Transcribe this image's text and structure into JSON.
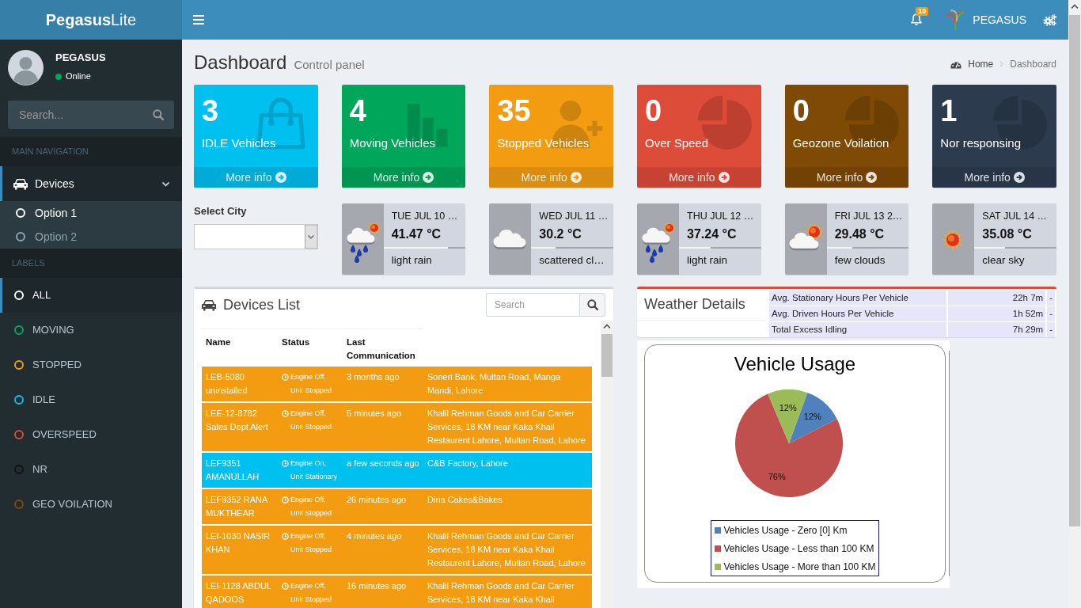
{
  "logo": {
    "text": "**Pegasus**Lite"
  },
  "navbar": {
    "notification_count": "10",
    "user_name": "PEGASUS"
  },
  "sidebar": {
    "user": {
      "name": "PEGASUS",
      "status": "Online"
    },
    "search": {
      "placeholder": "Search..."
    },
    "main_navigation": {
      "header": "MAIN NAVIGATION",
      "items": [
        {
          "label": "Devices",
          "selected": true,
          "expanded": true,
          "children": [
            {
              "label": "Option 1",
              "selected": true
            },
            {
              "label": "Option 2",
              "selected": false
            }
          ]
        }
      ]
    },
    "labels": {
      "header": "LABELS",
      "items": [
        {
          "label": "ALL",
          "color": "#ffffff",
          "selected": true
        },
        {
          "label": "MOVING",
          "color": "#00a65a",
          "selected": false
        },
        {
          "label": "STOPPED",
          "color": "#f39c12",
          "selected": false
        },
        {
          "label": "IDLE",
          "color": "#00c0ef",
          "selected": false
        },
        {
          "label": "OVERSPEED",
          "color": "#dd4b39",
          "selected": false
        },
        {
          "label": "NR",
          "color": "#111111",
          "selected": false
        },
        {
          "label": "GEO VOILATION",
          "color": "#7f4a05",
          "selected": false
        }
      ]
    }
  },
  "page_header": {
    "title": "Dashboard",
    "subtitle": "Control panel",
    "breadcrumb": [
      {
        "label": "Home",
        "selected": false
      },
      {
        "label": "Dashboard",
        "selected": true
      }
    ]
  },
  "stat_boxes": [
    {
      "count": "3",
      "label": "IDLE Vehicles",
      "link": "More info",
      "color": "#00c0ef",
      "kind": "bag"
    },
    {
      "count": "4",
      "label": "Moving Vehicles",
      "link": "More info",
      "color": "#00a65a",
      "kind": "bars"
    },
    {
      "count": "35",
      "label": "Stopped Vehicles",
      "link": "More info",
      "color": "#f39c12",
      "kind": "person_add"
    },
    {
      "count": "0",
      "label": "Over Speed",
      "link": "More info",
      "color": "#dd4b39",
      "kind": "pie"
    },
    {
      "count": "0",
      "label": "Geozone Voilation",
      "link": "More info",
      "color": "#7f4a05",
      "kind": "pie"
    },
    {
      "count": "1",
      "label": "Nor responsing",
      "link": "More info",
      "color": "#2c3b4e",
      "kind": "pie"
    }
  ],
  "city_select": {
    "label": "Select City"
  },
  "weather_forecast": [
    {
      "date": "TUE JUL 10 …",
      "temperature": "41.47 °C",
      "level": 0.78,
      "description": "light rain",
      "kind": "rain"
    },
    {
      "date": "WED JUL 11 …",
      "temperature": "30.2 °C",
      "level": 0.3,
      "description": "scattered cl…",
      "kind": "clouds"
    },
    {
      "date": "THU JUL 12 …",
      "temperature": "37.24 °C",
      "level": 0.39,
      "description": "light rain",
      "kind": "rain"
    },
    {
      "date": "FRI JUL 13 2…",
      "temperature": "29.48 °C",
      "level": 0.31,
      "description": "few clouds",
      "kind": "few_clouds"
    },
    {
      "date": "SAT JUL 14 …",
      "temperature": "35.08 °C",
      "level": 0.37,
      "description": "clear sky",
      "kind": "clear"
    }
  ],
  "devices_list": {
    "title": "Devices List",
    "search": {
      "placeholder": "Search"
    },
    "columns": [
      "Name",
      "Status",
      "Last Communication"
    ],
    "rows": [
      {
        "name": "LEB-5080 uninstalled",
        "status": "Engine Off, Unit Stopped",
        "last_communication": "3 months ago",
        "column_4": "Soneri Bank, Multan Road, Manga Mandi, Lahore",
        "color": "#f39c12"
      },
      {
        "name": "LEE-12-8782 Sales Dept Alert",
        "status": "Engine Off, Unit Stopped",
        "last_communication": "5 minutes ago",
        "column_4": "Khalil Rehman Goods and Car Carrier Services, 18 KM near Kaka Khail Restaurent Lahore, Multan Road, Lahore",
        "color": "#f39c12"
      },
      {
        "name": "LEF9351 AMANULLAH",
        "status": "Engine On, Unit Stationary",
        "last_communication": "a few seconds ago",
        "column_4": "C&B Factory, Lahore",
        "color": "#00c0ef"
      },
      {
        "name": "LEF9352 RANA MUKTHEAR",
        "status": "Engine Off, Unit Stopped",
        "last_communication": "26 minutes ago",
        "column_4": "Dina Cakes&Bakes",
        "color": "#f39c12"
      },
      {
        "name": "LEI-1030 NASIR KHAN",
        "status": "Engine Off, Unit Stopped",
        "last_communication": "4 minutes ago",
        "column_4": "Khalil Rehman Goods and Car Carrier Services, 18 KM near Kaka Khail Restaurent Lahore, Multan Road, Lahore",
        "color": "#f39c12"
      },
      {
        "name": "LEI-1128 ABDUL QADOOS",
        "status": "Engine Off, Unit Stopped",
        "last_communication": "16 minutes ago",
        "column_4": "Khalil Rehman Goods and Car Carrier Services, 18 KM near Kaka Khail",
        "color": "#f39c12"
      }
    ]
  },
  "weather_details": {
    "title": "Weather Details",
    "rows": [
      {
        "metric": "Avg. Stationary Hours Per Vehicle",
        "value": "22h 7m",
        "column_3": "-"
      },
      {
        "metric": "Avg. Driven Hours Per Vehicle",
        "value": "1h 52m",
        "column_3": "-"
      },
      {
        "metric": "Total Excess Idling",
        "value": "7h 29m",
        "column_3": "-"
      }
    ]
  },
  "vehicle_usage": {
    "chart_data": {
      "type": "pie",
      "title": "Vehicle Usage",
      "categories": [
        "Vehicles Usage - Zero [0] Km",
        "Vehicles Usage - Less than 100 KM",
        "Vehicles Usage - More than 100 KM"
      ],
      "values": [
        12,
        76,
        12
      ],
      "value_labels": [
        "12%",
        "76%",
        "12%"
      ],
      "legend": "bottom"
    }
  }
}
